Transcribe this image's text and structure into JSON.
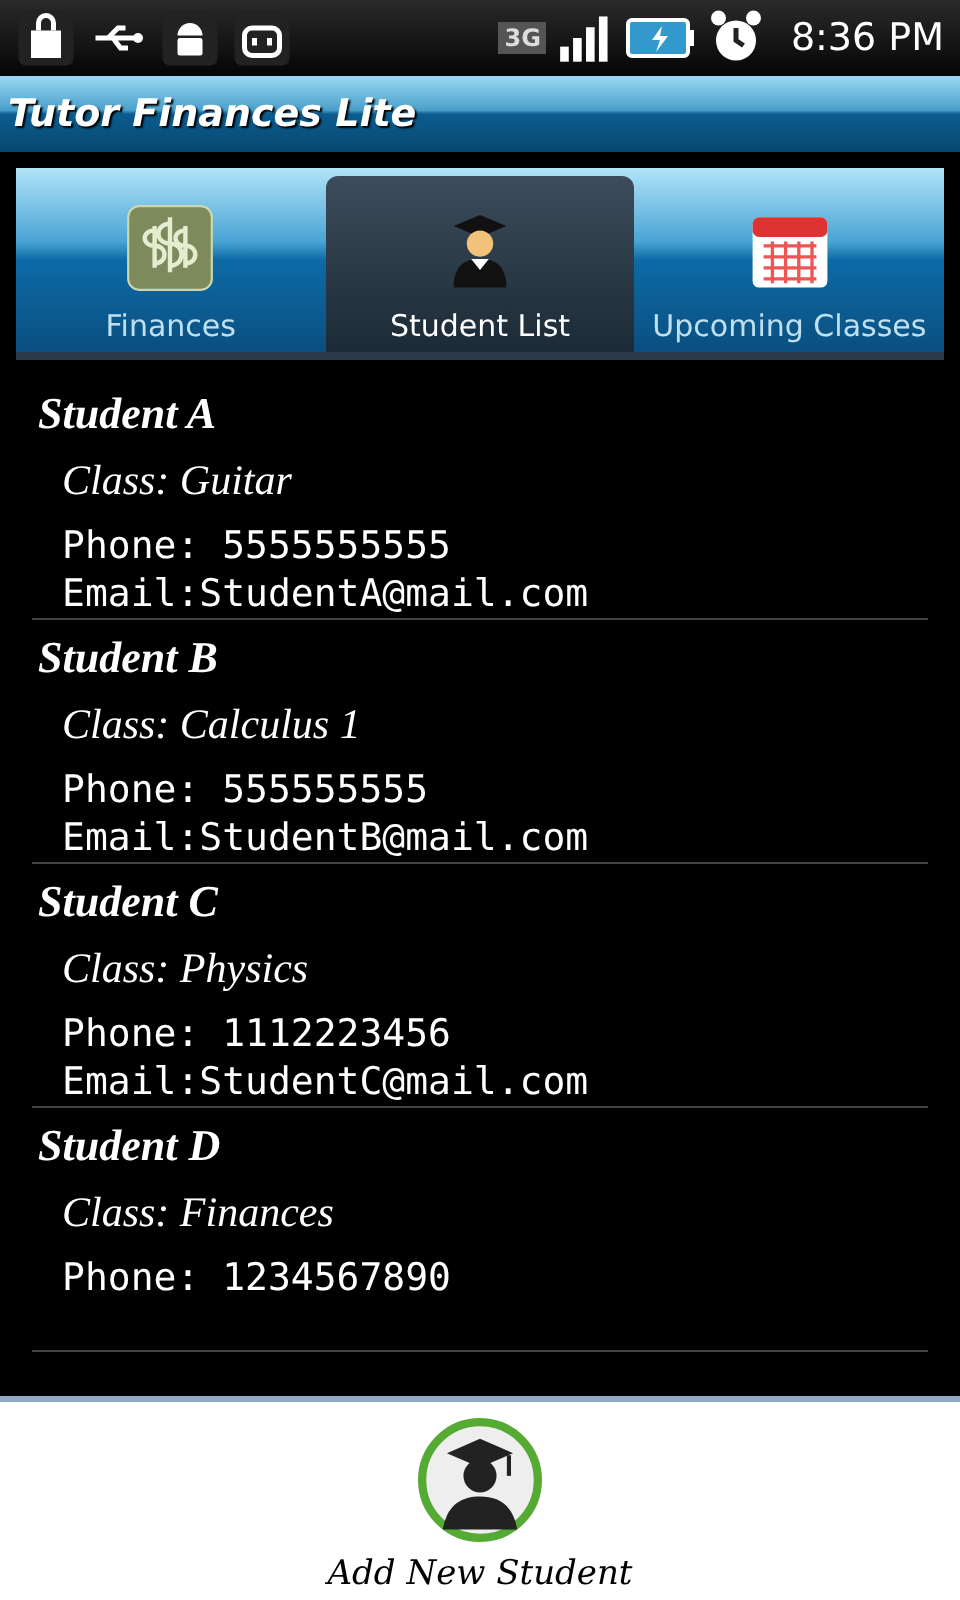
{
  "status_bar": {
    "time": "8:36 PM",
    "network": "3G"
  },
  "app_bar": {
    "title": "Tutor Finances Lite"
  },
  "tabs": [
    {
      "label": "Finances",
      "selected": false
    },
    {
      "label": "Student List",
      "selected": true
    },
    {
      "label": "Upcoming Classes",
      "selected": false
    }
  ],
  "students": [
    {
      "name": "Student A",
      "class": "Class: Guitar",
      "phone": "Phone:  5555555555",
      "email": "Email:StudentA@mail.com"
    },
    {
      "name": "Student B",
      "class": "Class: Calculus 1",
      "phone": "Phone:  555555555",
      "email": "Email:StudentB@mail.com"
    },
    {
      "name": "Student C",
      "class": "Class: Physics",
      "phone": "Phone:  1112223456",
      "email": "Email:StudentC@mail.com"
    },
    {
      "name": "Student D",
      "class": "Class: Finances",
      "phone": "Phone:  1234567890"
    }
  ],
  "add_button": {
    "label": "Add New Student"
  }
}
